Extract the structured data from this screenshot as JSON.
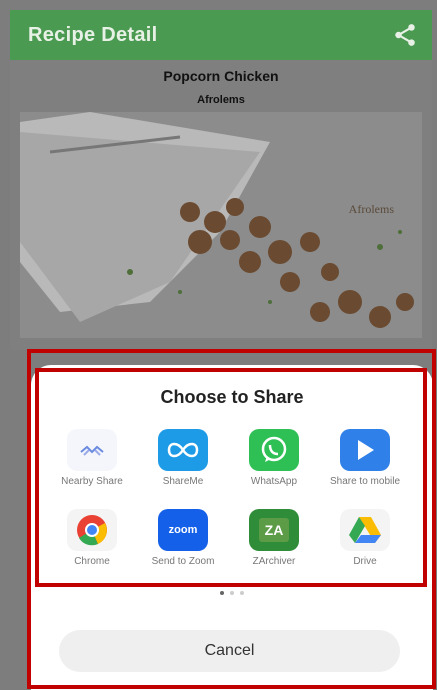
{
  "appbar": {
    "title": "Recipe Detail",
    "share_icon": "share-icon"
  },
  "recipe": {
    "title": "Popcorn Chicken",
    "author": "Afrolems",
    "watermark": "Afrolems"
  },
  "share_sheet": {
    "title": "Choose to Share",
    "apps": [
      {
        "label": "Nearby Share",
        "icon": "nearby-share-icon"
      },
      {
        "label": "ShareMe",
        "icon": "shareme-icon"
      },
      {
        "label": "WhatsApp",
        "icon": "whatsapp-icon"
      },
      {
        "label": "Share to mobile",
        "icon": "share-to-mobile-icon"
      },
      {
        "label": "Chrome",
        "icon": "chrome-icon"
      },
      {
        "label": "Send to Zoom",
        "icon": "zoom-icon",
        "icon_text": "zoom"
      },
      {
        "label": "ZArchiver",
        "icon": "zarchiver-icon",
        "icon_text": "ZA"
      },
      {
        "label": "Drive",
        "icon": "drive-icon"
      }
    ],
    "cancel_label": "Cancel"
  },
  "colors": {
    "appbar": "#4b9a52",
    "highlight": "#c10000"
  }
}
